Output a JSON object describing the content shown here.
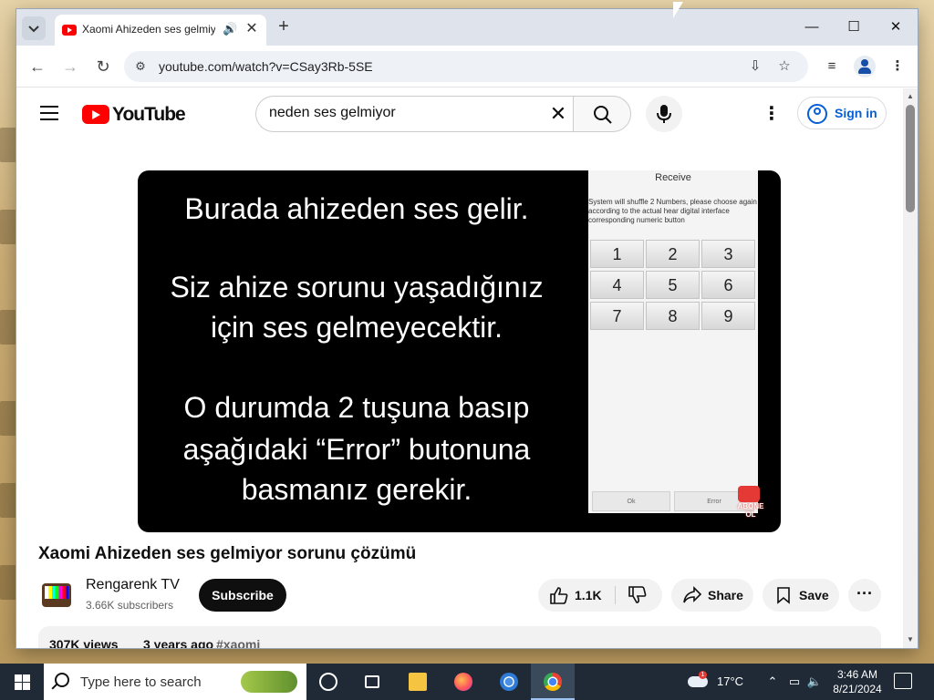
{
  "browser": {
    "tab_title": "Xaomi Ahizeden ses gelmiyor sorunu çözümü - YouTube",
    "url": "youtube.com/watch?v=CSay3Rb-5SE",
    "icons": {
      "tab_search": "chevron-down-icon",
      "audio": "speaker-icon",
      "close_tab": "close-icon",
      "new_tab": "plus-icon",
      "minimize": "minimize-icon",
      "maximize": "maximize-icon",
      "close_window": "close-icon",
      "back": "arrow-left-icon",
      "forward": "arrow-right-icon",
      "reload": "reload-icon",
      "site_info": "tune-icon",
      "install": "install-icon",
      "bookmark": "star-icon",
      "media": "media-queue-icon",
      "profile": "profile-icon",
      "menu": "kebab-icon"
    }
  },
  "youtube": {
    "logo_text": "YouTube",
    "search": {
      "query": "neden ses gelmiyor"
    },
    "sign_in_label": "Sign in",
    "accent": "#ff0000",
    "link_color": "#065fd4"
  },
  "video": {
    "overlay_lines": [
      "Burada ahizeden ses gelir.",
      "Siz ahize sorunu yaşadığınız",
      "için ses gelmeyecektir.",
      "O durumda 2 tuşuna basıp",
      "aşağıdaki “Error” butonuna",
      "basmanız gerekir."
    ],
    "phone": {
      "title": "Receive",
      "description": "System will shuffle 2 Numbers, please choose again according to the actual hear digital interface corresponding numeric button",
      "keys": [
        "1",
        "2",
        "3",
        "4",
        "5",
        "6",
        "7",
        "8",
        "9"
      ],
      "ok_label": "Ok",
      "error_label": "Error"
    },
    "badge_text": [
      "ABONE",
      "OL"
    ],
    "title": "Xaomi Ahizeden ses gelmiyor sorunu çözümü",
    "channel": {
      "name": "Rengarenk TV",
      "subscribers": "3.66K subscribers"
    },
    "subscribe_label": "Subscribe",
    "likes": "1.1K",
    "share_label": "Share",
    "save_label": "Save",
    "views": "307K views",
    "published": "3 years ago",
    "hashtag": "#xaomi"
  },
  "taskbar": {
    "search_placeholder": "Type here to search",
    "weather_badge": "1",
    "temperature": "17°C",
    "time": "3:46 AM",
    "date": "8/21/2024"
  }
}
